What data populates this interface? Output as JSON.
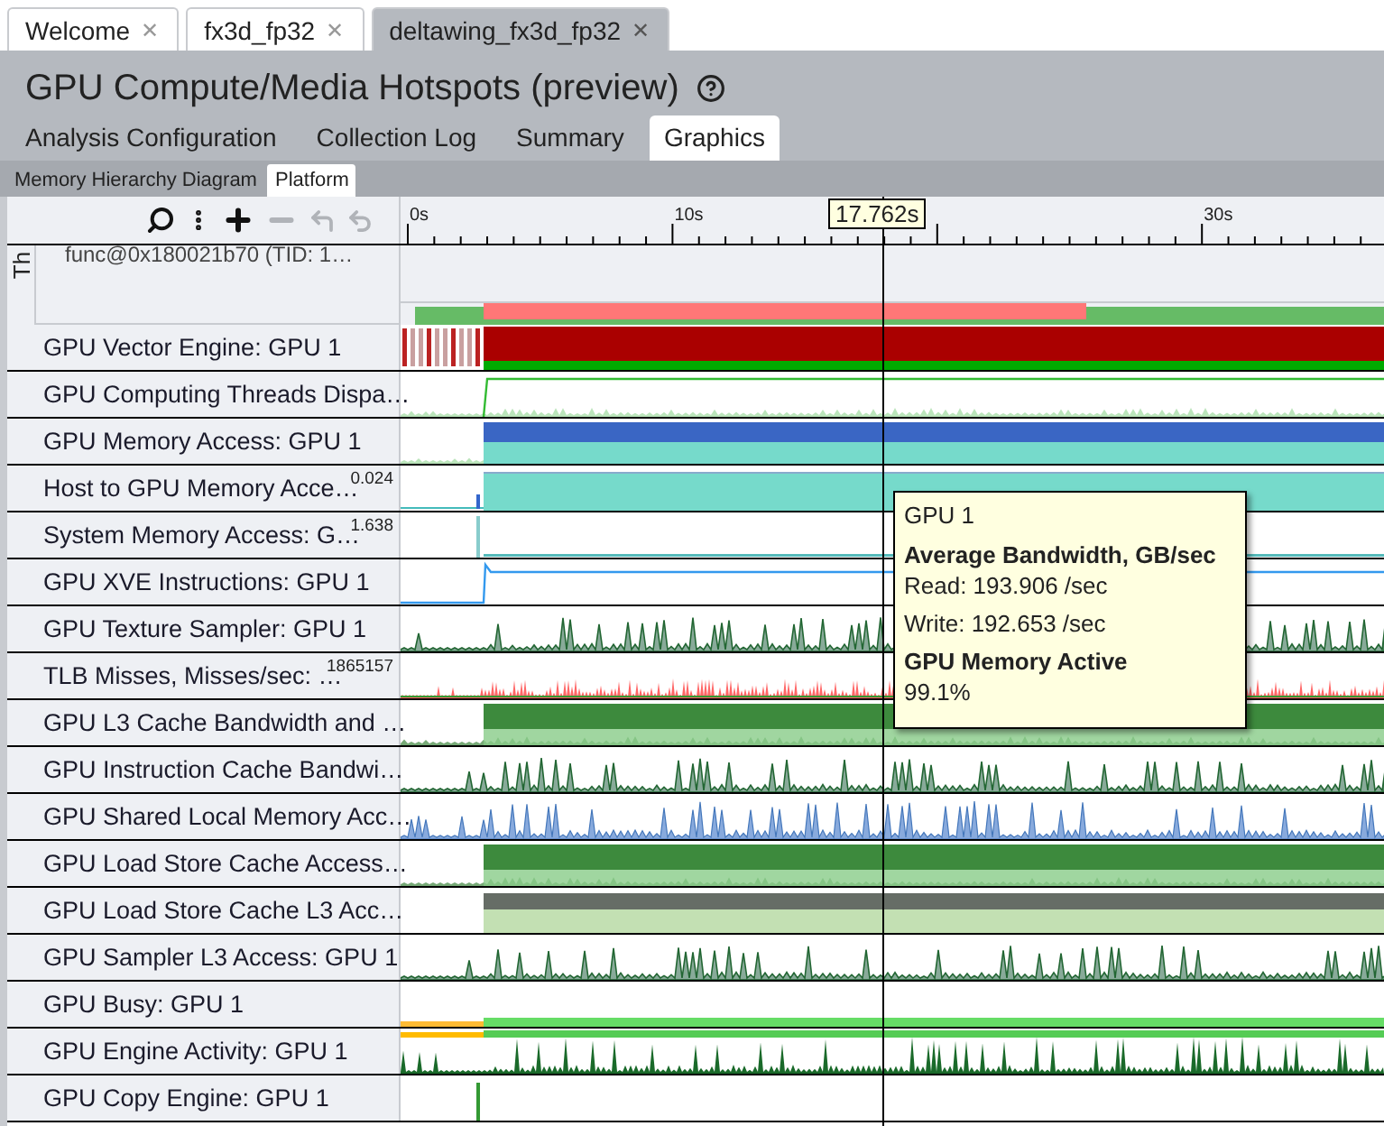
{
  "document_tabs": [
    {
      "label": "Welcome",
      "selected": false,
      "close": "✕"
    },
    {
      "label": "fx3d_fp32",
      "selected": false,
      "close": "✕"
    },
    {
      "label": "deltawing_fx3d_fp32",
      "selected": true,
      "close": "✕"
    }
  ],
  "title": "GPU Compute/Media Hotspots (preview)",
  "analysis_tabs": [
    {
      "label": "Analysis Configuration",
      "selected": false
    },
    {
      "label": "Collection Log",
      "selected": false
    },
    {
      "label": "Summary",
      "selected": false
    },
    {
      "label": "Graphics",
      "selected": true
    }
  ],
  "view_tabs": [
    {
      "label": "Memory Hierarchy Diagram",
      "selected": false
    },
    {
      "label": "Platform",
      "selected": true
    }
  ],
  "toolbar": [
    {
      "kind": "search",
      "disabled": false
    },
    {
      "kind": "more",
      "disabled": false
    },
    {
      "kind": "zoom-in",
      "disabled": false
    },
    {
      "kind": "zoom-out",
      "disabled": true
    },
    {
      "kind": "undo",
      "disabled": true
    },
    {
      "kind": "reset",
      "disabled": true
    }
  ],
  "ruler": {
    "ticks": [
      {
        "label": "0s"
      },
      {
        "label": "10s"
      },
      {
        "label": "30s"
      }
    ],
    "cursor": "17.762s"
  },
  "thread_group": {
    "label": "Th",
    "thread": "func@0x180021b70 (TID: 1…"
  },
  "tracks": [
    {
      "label": "GPU Vector Engine: GPU 1",
      "kind": "band-red"
    },
    {
      "label": "GPU Computing Threads Dispa…",
      "kind": "line-green"
    },
    {
      "label": "GPU Memory Access: GPU 1",
      "kind": "band-blue"
    },
    {
      "label": "Host to GPU Memory Acce…",
      "scale": "0.024",
      "kind": "fill-teal"
    },
    {
      "label": "System Memory Access: G…",
      "scale": "1.638",
      "kind": "flat"
    },
    {
      "label": "GPU XVE Instructions: GPU 1",
      "kind": "line-blue"
    },
    {
      "label": "GPU Texture Sampler: GPU 1",
      "kind": "spikes-green"
    },
    {
      "label": "TLB Misses, Misses/sec: …",
      "scale": "1865157",
      "kind": "noise-red"
    },
    {
      "label": "GPU L3 Cache Bandwidth and …",
      "kind": "band-green"
    },
    {
      "label": "GPU Instruction Cache Bandwi…",
      "kind": "spikes-green"
    },
    {
      "label": "GPU Shared Local Memory Acc…",
      "kind": "spikes-blue"
    },
    {
      "label": "GPU Load Store Cache Access…",
      "kind": "band-green"
    },
    {
      "label": "GPU Load Store Cache L3 Acc…",
      "kind": "band-gray"
    },
    {
      "label": "GPU Sampler L3 Access: GPU 1",
      "kind": "spikes-green"
    },
    {
      "label": "GPU Busy: GPU 1",
      "kind": "bar-green"
    },
    {
      "label": "GPU Engine Activity: GPU 1",
      "kind": "spikes-mixed"
    },
    {
      "label": "GPU Copy Engine: GPU 1",
      "kind": "blip"
    }
  ],
  "tooltip": {
    "title": "GPU 1",
    "sections": [
      {
        "heading": "Average Bandwidth, GB/sec",
        "lines": [
          "Read: 193.906 /sec",
          "Write: 192.653 /sec"
        ]
      },
      {
        "heading": "GPU Memory Active",
        "lines": [
          "99.1%"
        ]
      }
    ]
  }
}
